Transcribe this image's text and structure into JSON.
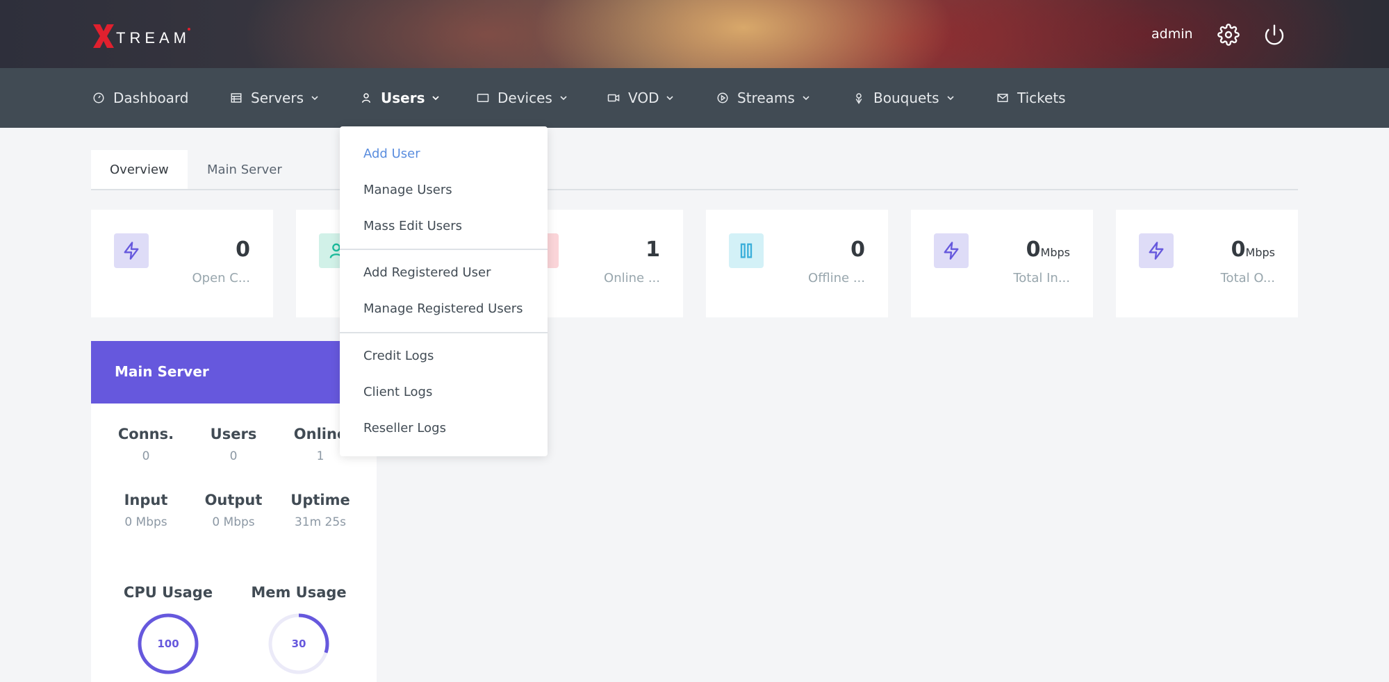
{
  "header": {
    "logo_text": "TREAM",
    "user": "admin",
    "icons": [
      "gear-icon",
      "power-icon"
    ]
  },
  "nav": {
    "items": [
      {
        "label": "Dashboard",
        "icon": "dashboard-icon"
      },
      {
        "label": "Servers",
        "icon": "servers-icon"
      },
      {
        "label": "Users",
        "icon": "user-icon",
        "active": true
      },
      {
        "label": "Devices",
        "icon": "devices-icon"
      },
      {
        "label": "VOD",
        "icon": "video-icon"
      },
      {
        "label": "Streams",
        "icon": "play-icon"
      },
      {
        "label": "Bouquets",
        "icon": "bouquet-icon"
      },
      {
        "label": "Tickets",
        "icon": "mail-icon"
      }
    ]
  },
  "tabs": [
    {
      "label": "Overview",
      "active": true
    },
    {
      "label": "Main Server",
      "active": false
    }
  ],
  "cards": [
    {
      "value": "0",
      "unit": "",
      "label": "Open C...",
      "icon": "bolt-icon"
    },
    {
      "value": "",
      "unit": "",
      "label": "",
      "icon": "user-icon"
    },
    {
      "value": "1",
      "unit": "",
      "label": "Online ...",
      "icon": ""
    },
    {
      "value": "0",
      "unit": "",
      "label": "Offline ...",
      "icon": "pause-icon"
    },
    {
      "value": "0",
      "unit": "Mbps",
      "label": "Total In...",
      "icon": "bolt-icon"
    },
    {
      "value": "0",
      "unit": "Mbps",
      "label": "Total O...",
      "icon": "bolt-icon"
    }
  ],
  "server": {
    "title": "Main Server",
    "stats": [
      {
        "label": "Conns.",
        "value": "0"
      },
      {
        "label": "Users",
        "value": "0"
      },
      {
        "label": "Online",
        "value": "1"
      },
      {
        "label": "Input",
        "value": "0 Mbps"
      },
      {
        "label": "Output",
        "value": "0 Mbps"
      },
      {
        "label": "Uptime",
        "value": "31m 25s"
      }
    ],
    "cpu": {
      "label": "CPU Usage",
      "value": "100",
      "percent": 100
    },
    "mem": {
      "label": "Mem Usage",
      "value": "30",
      "percent": 30
    }
  },
  "dropdown": {
    "groups": [
      [
        "Add User",
        "Manage Users",
        "Mass Edit Users"
      ],
      [
        "Add Registered User",
        "Manage Registered Users"
      ],
      [
        "Credit Logs",
        "Client Logs",
        "Reseller Logs"
      ]
    ],
    "active": "Add User"
  },
  "colors": {
    "accent": "#6658dd",
    "nav_bg": "#414b54",
    "link_blue": "#5a8dde",
    "logo_red": "#e0202e"
  }
}
